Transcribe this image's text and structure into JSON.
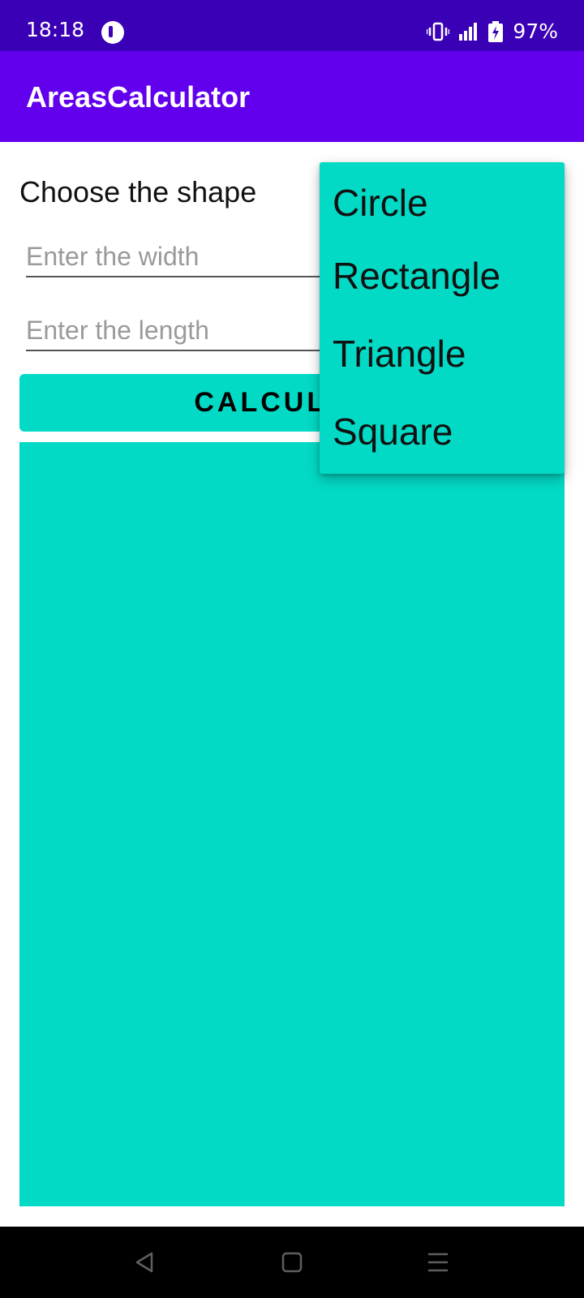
{
  "status_bar": {
    "time": "18:18",
    "battery": "97%",
    "icons": [
      "app-notification-icon",
      "vibrate-icon",
      "signal-icon",
      "battery-charging-icon"
    ]
  },
  "app_bar": {
    "title": "AreasCalculator"
  },
  "form": {
    "shape_label": "Choose the shape",
    "width_placeholder": "Enter the width",
    "length_placeholder": "Enter the length",
    "calculate_label": "CALCULATE"
  },
  "dropdown": {
    "options": [
      "Circle",
      "Rectangle",
      "Triangle",
      "Square"
    ]
  },
  "nav_bar": {
    "icons": [
      "back-icon",
      "home-icon",
      "menu-icon"
    ]
  },
  "colors": {
    "status_bar": "#3a00b5",
    "app_bar": "#6200ee",
    "accent": "#03dac5",
    "nav_bar": "#000000"
  }
}
